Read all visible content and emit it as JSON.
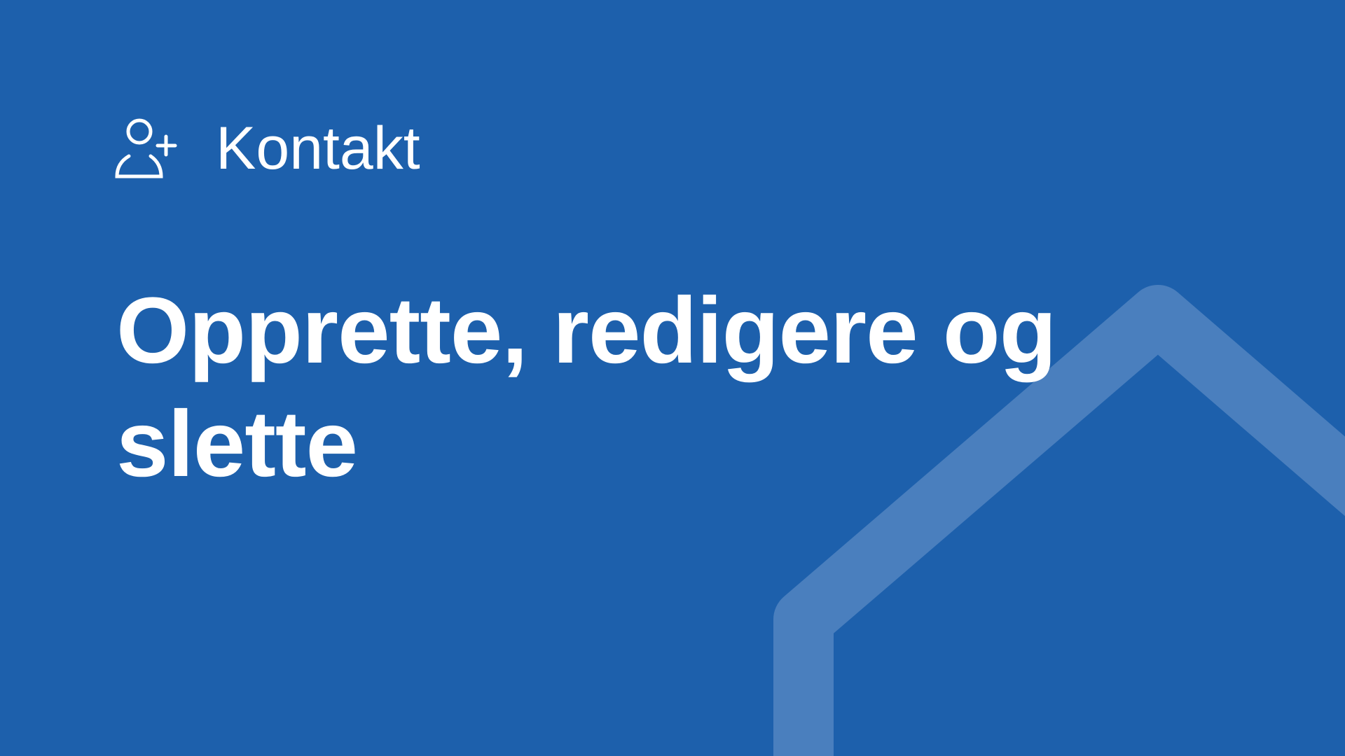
{
  "header": {
    "icon": "add-contact-icon",
    "section_label": "Kontakt"
  },
  "main": {
    "title": "Opprette, redigere og slette"
  },
  "colors": {
    "background": "#1d60ac",
    "decoration": "#4a7fbe",
    "text": "#ffffff"
  }
}
